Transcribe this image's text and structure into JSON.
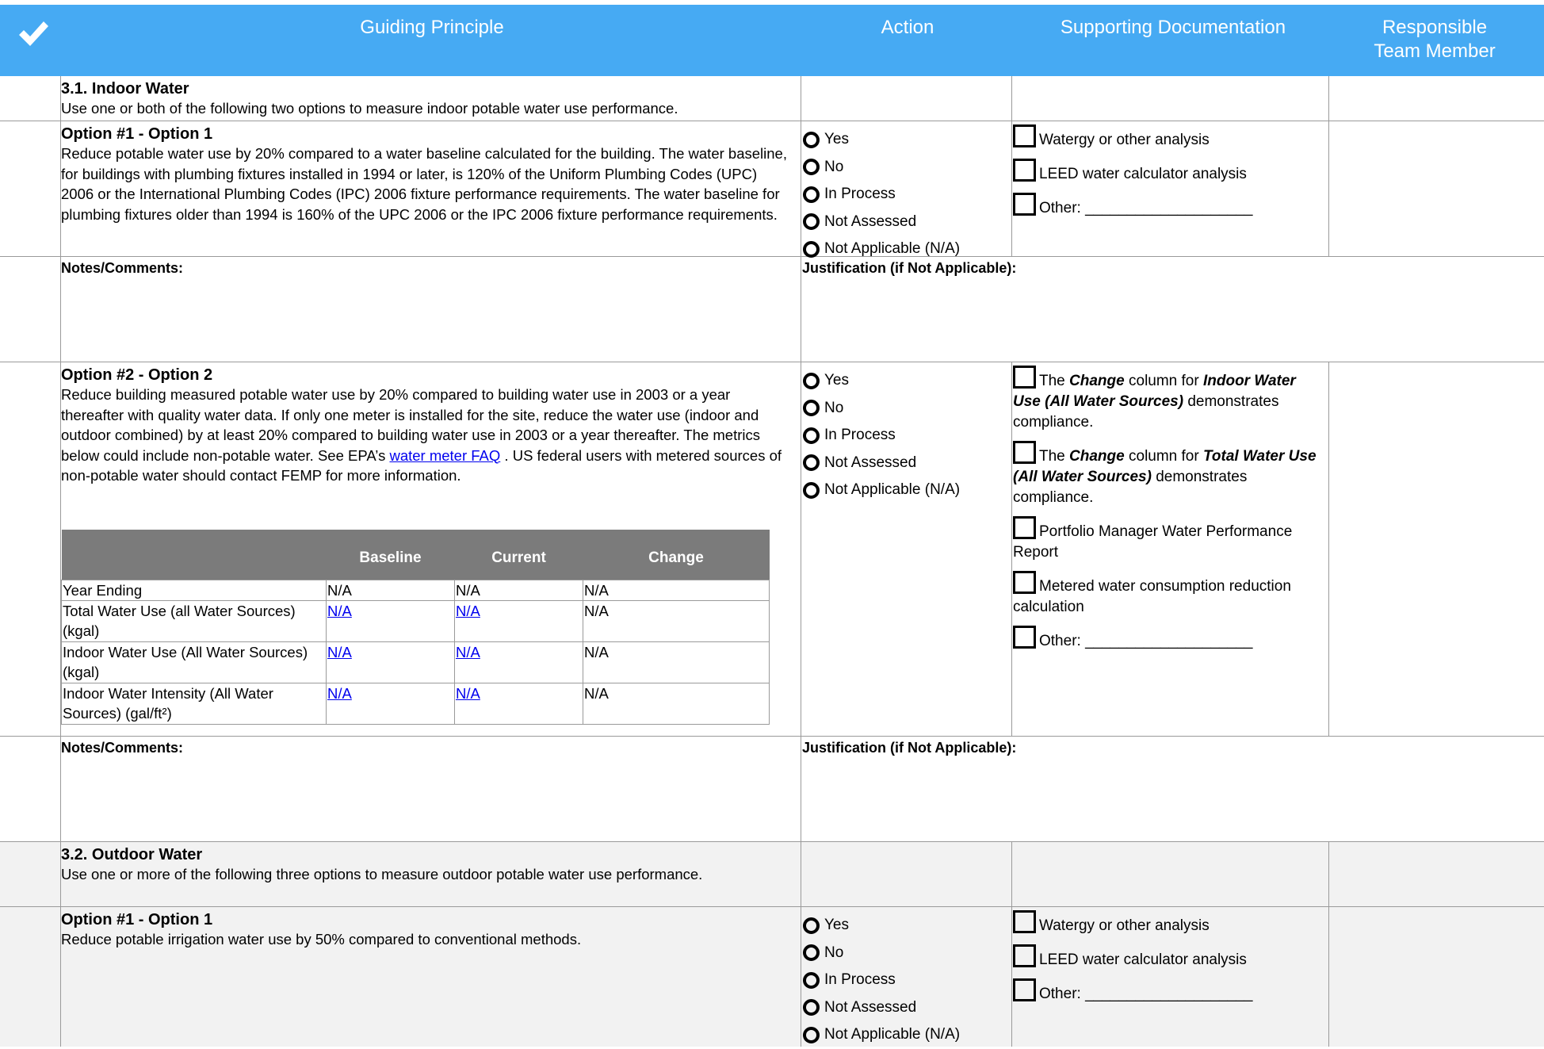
{
  "header": {
    "columns": [
      "Guiding Principle",
      "Action",
      "Supporting Documentation",
      "Responsible Team Member"
    ],
    "bg_color": "#46aaf3"
  },
  "actions_options": [
    "Yes",
    "No",
    "In Process",
    "Not Assessed",
    "Not Applicable (N/A)"
  ],
  "section_3_1": {
    "title": "3.1. Indoor Water",
    "desc": "Use one or both of the following two options to measure indoor potable water use performance.",
    "option1": {
      "title": "Option #1 - Option 1",
      "body": "Reduce potable water use by 20% compared to a water baseline calculated for the building. The water baseline, for buildings with plumbing fixtures installed in 1994 or later, is 120% of the Uniform Plumbing Codes (UPC) 2006 or the International Plumbing Codes (IPC) 2006 fixture performance requirements. The water baseline for plumbing fixtures older than 1994 is 160% of the UPC 2006 or the IPC 2006 fixture performance requirements.",
      "docs": [
        "Watergy or other analysis",
        "LEED water calculator analysis",
        "Other: ____________________"
      ]
    },
    "notes_label": "Notes/Comments:",
    "justification_label": "Justification (if Not Applicable):",
    "option2": {
      "title": "Option #2 - Option 2",
      "body_pre": "Reduce building measured potable water use by 20% compared to building water use in 2003 or a year thereafter with quality water data. If only one meter is installed for the site, reduce the water use (indoor and outdoor combined) by at least 20% compared to building water use in 2003 or a year thereafter. The metrics below could include non-potable water. See EPA’s ",
      "link_text": "water meter FAQ",
      "body_post": " . US federal users with metered sources of non-potable water should contact FEMP for more information.",
      "docs": {
        "d1_pre": "The ",
        "d1_bold1": "Change",
        "d1_mid": " column for ",
        "d1_bold2": "Indoor Water Use (All Water Sources)",
        "d1_post": " demonstrates compliance.",
        "d2_pre": "The ",
        "d2_bold1": "Change",
        "d2_mid": " column for ",
        "d2_bold2": "Total Water Use (All Water Sources)",
        "d2_post": " demonstrates compliance.",
        "d3": "Portfolio Manager Water Performance Report",
        "d4": "Metered water consumption reduction calculation",
        "d5": "Other: ____________________"
      },
      "table": {
        "headers": [
          "",
          "Baseline",
          "Current",
          "Change"
        ],
        "rows": [
          {
            "label": "Year Ending",
            "baseline": "N/A",
            "current": "N/A",
            "change": "N/A"
          },
          {
            "label": "Total Water Use (all Water Sources) (kgal)",
            "baseline": "N/A",
            "current": "N/A",
            "change": "N/A"
          },
          {
            "label": "Indoor Water Use (All Water Sources) (kgal)",
            "baseline": "N/A",
            "current": "N/A",
            "change": "N/A"
          },
          {
            "label": "Indoor Water Intensity (All Water Sources) (gal/ft²)",
            "baseline": "N/A",
            "current": "N/A",
            "change": "N/A"
          }
        ]
      }
    }
  },
  "section_3_2": {
    "title": "3.2. Outdoor Water",
    "desc": "Use one or more of the following three options to measure outdoor potable water use performance.",
    "option1": {
      "title": "Option #1 - Option 1",
      "body": "Reduce potable irrigation water use by 50% compared to conventional methods.",
      "docs": [
        "Watergy or other analysis",
        "LEED water calculator analysis",
        "Other: ____________________"
      ]
    }
  }
}
